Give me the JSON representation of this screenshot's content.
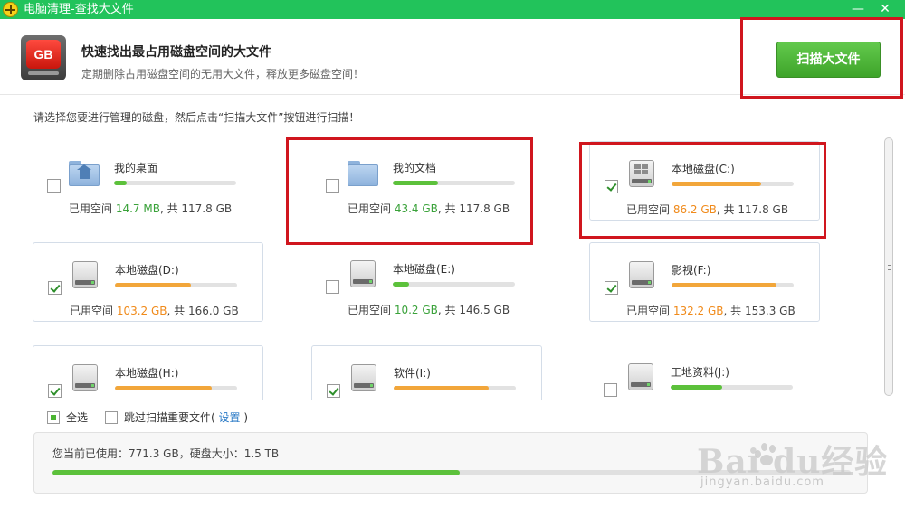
{
  "window": {
    "title": "电脑清理-查找大文件",
    "minimize": "—",
    "close": "✕"
  },
  "header": {
    "icon_text": "GB",
    "title": "快速找出最占用磁盘空间的大文件",
    "subtitle": "定期删除占用磁盘空间的无用大文件，释放更多磁盘空间！",
    "scan_label": "扫描大文件"
  },
  "instruction": "请选择您要进行管理的磁盘，然后点击“扫描大文件”按钮进行扫描！",
  "drives": [
    {
      "name": "我的桌面",
      "kind": "folder-home",
      "checked": false,
      "used": "14.7 MB",
      "total": "117.8 GB",
      "usage_color": "green",
      "bar_color": "green",
      "fill": 0.1
    },
    {
      "name": "我的文档",
      "kind": "folder",
      "checked": false,
      "used": "43.4 GB",
      "total": "117.8 GB",
      "usage_color": "green",
      "bar_color": "green",
      "fill": 0.37
    },
    {
      "name": "本地磁盘(C:)",
      "kind": "drive-windows",
      "checked": true,
      "used": "86.2 GB",
      "total": "117.8 GB",
      "usage_color": "orange",
      "bar_color": "orange",
      "fill": 0.73
    },
    {
      "name": "本地磁盘(D:)",
      "kind": "drive",
      "checked": true,
      "used": "103.2 GB",
      "total": "166.0 GB",
      "usage_color": "orange",
      "bar_color": "orange",
      "fill": 0.62
    },
    {
      "name": "本地磁盘(E:)",
      "kind": "drive",
      "checked": false,
      "used": "10.2 GB",
      "total": "146.5 GB",
      "usage_color": "green",
      "bar_color": "green",
      "fill": 0.13
    },
    {
      "name": "影视(F:)",
      "kind": "drive",
      "checked": true,
      "used": "132.2 GB",
      "total": "153.3 GB",
      "usage_color": "orange",
      "bar_color": "orange",
      "fill": 0.86
    },
    {
      "name": "本地磁盘(H:)",
      "kind": "drive",
      "checked": true,
      "used": "",
      "total": "",
      "usage_color": "orange",
      "bar_color": "orange",
      "fill": 0.79
    },
    {
      "name": "软件(I:)",
      "kind": "drive",
      "checked": true,
      "used": "",
      "total": "",
      "usage_color": "orange",
      "bar_color": "orange",
      "fill": 0.78
    },
    {
      "name": "工地资料(J:)",
      "kind": "drive",
      "checked": false,
      "used": "",
      "total": "",
      "usage_color": "green",
      "bar_color": "green",
      "fill": 0.42
    }
  ],
  "labels": {
    "used_prefix": "已用空间 ",
    "total_sep": ", 共 "
  },
  "options": {
    "select_all": "全选",
    "skip_prefix": "跳过扫描重要文件(",
    "settings": "设置",
    "skip_suffix": ")"
  },
  "summary": {
    "text": "您当前已使用：771.3 GB，硬盘大小：1.5 TB",
    "fill": 0.51
  },
  "watermark": {
    "brand": "Bai  du经验",
    "url": "jingyan.baidu.com"
  },
  "colors": {
    "titlebar": "#22c35b",
    "accent_green": "#5cc13b",
    "accent_orange": "#f2a63a",
    "annotation": "#d0161e"
  }
}
